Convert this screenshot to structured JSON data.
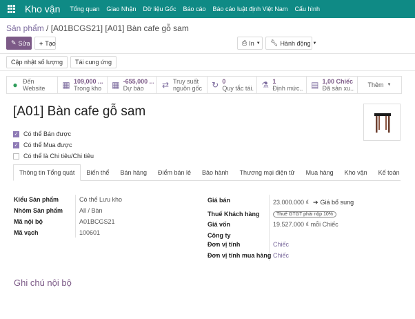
{
  "topbar": {
    "app_name": "Kho vận",
    "menu": [
      "Tổng quan",
      "Giao Nhận",
      "Dữ liệu Gốc",
      "Báo cáo",
      "Báo cáo luật định Việt Nam",
      "Cấu hình"
    ]
  },
  "breadcrumb": {
    "parent": "Sản phẩm",
    "separator": " / ",
    "current": "[A01BCGS21] [A01] Bàn cafe gỗ sam"
  },
  "toolbar": {
    "edit_label": "Sửa",
    "create_label": "Tạo",
    "print_label": "In",
    "action_label": "Hành động"
  },
  "actions": {
    "update_qty": "Cập nhật số lượng",
    "replenish": "Tái cung ứng"
  },
  "stats": [
    {
      "icon": "globe-icon",
      "value": "Đến",
      "label": "Website"
    },
    {
      "icon": "cubes-icon",
      "value": "109,000 ...",
      "label": "Trong kho"
    },
    {
      "icon": "cubes-icon",
      "value": "-655,000 ...",
      "label": "Dự báo"
    },
    {
      "icon": "exchange-icon",
      "value": "Truy suất",
      "label": "nguồn gốc"
    },
    {
      "icon": "refresh-icon",
      "value": "0",
      "label": "Quy tắc tái..."
    },
    {
      "icon": "flask-icon",
      "value": "1",
      "label": "Định mức..."
    },
    {
      "icon": "chart-icon",
      "value": "1,00 Chiếc",
      "label": "Đã sản xu..."
    }
  ],
  "more_label": "Thêm",
  "product": {
    "name": "[A01] Bàn cafe gỗ sam",
    "checks": [
      {
        "label": "Có thể Bán được",
        "checked": true
      },
      {
        "label": "Có thể Mua được",
        "checked": true
      },
      {
        "label": "Có thể là Chi tiêu/Chi tiêu",
        "checked": false
      }
    ]
  },
  "tabs": [
    "Thông tin Tổng quát",
    "Biến thể",
    "Bán hàng",
    "Điểm bán lẻ",
    "Bảo hành",
    "Thương mại điện tử",
    "Mua hàng",
    "Kho vận",
    "Kế toán"
  ],
  "left_fields": {
    "type_label": "Kiểu Sản phẩm",
    "type_value": "Có thể Lưu kho",
    "group_label": "Nhóm Sản phẩm",
    "group_value": "All / Bàn",
    "ref_label": "Mã nội bộ",
    "ref_value": "A01BCGS21",
    "barcode_label": "Mã vạch",
    "barcode_value": "100601"
  },
  "right_fields": {
    "price_label": "Giá bán",
    "price_value": "23.000.000 ₫",
    "extra_price_link": "Giá bổ sung",
    "tax_label": "Thuế Khách hàng",
    "tax_badge": "Thuế GTGT phải nộp 10%",
    "cost_label": "Giá vốn",
    "cost_value": "19.527.000 ₫ mỗi Chiếc",
    "company_label": "Công ty",
    "uom_label": "Đơn vị tính",
    "uom_value": "Chiếc",
    "po_uom_label": "Đơn vị tính mua hàng",
    "po_uom_value": "Chiếc"
  },
  "notes_title": "Ghi chú nội bộ"
}
